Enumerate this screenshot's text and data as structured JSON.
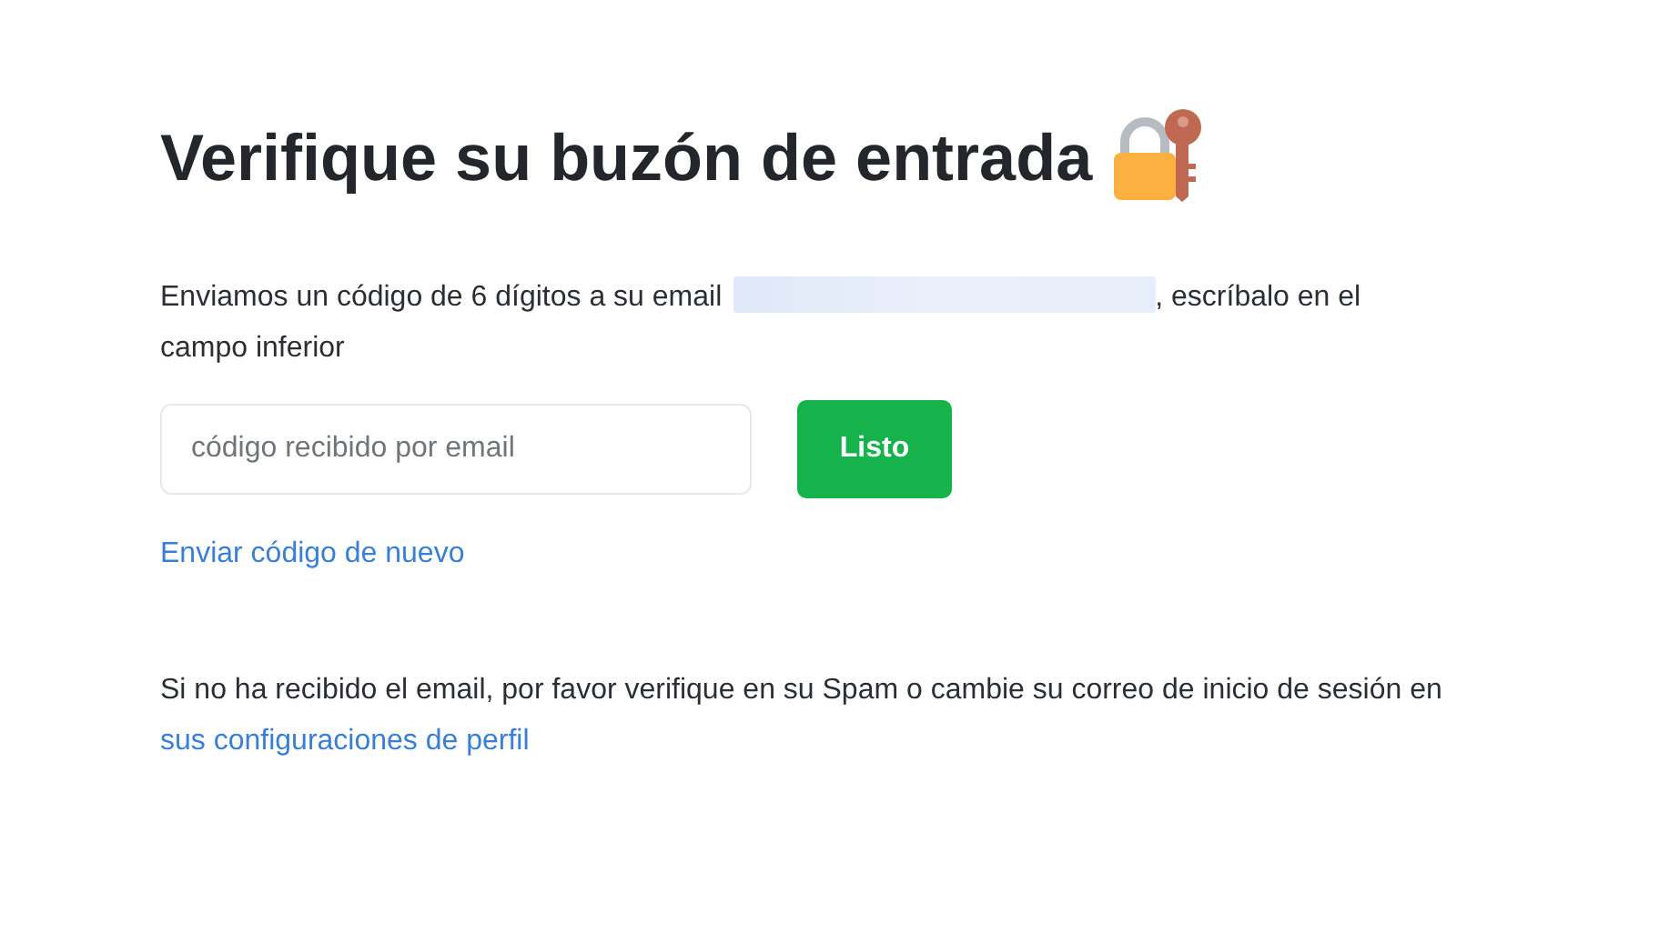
{
  "title": "Verifique su buzón de entrada",
  "intro": {
    "before": "Enviamos un código de 6 dígitos a su email",
    "after": ", escríbalo en el campo inferior"
  },
  "code_field": {
    "placeholder": "código recibido por email"
  },
  "submit_button": "Listo",
  "resend_link": "Enviar código de nuevo",
  "note": {
    "text": "Si no ha recibido el email, por favor verifique en su Spam o cambie su correo de inicio de sesión en",
    "link": "sus configuraciones de perfil"
  }
}
